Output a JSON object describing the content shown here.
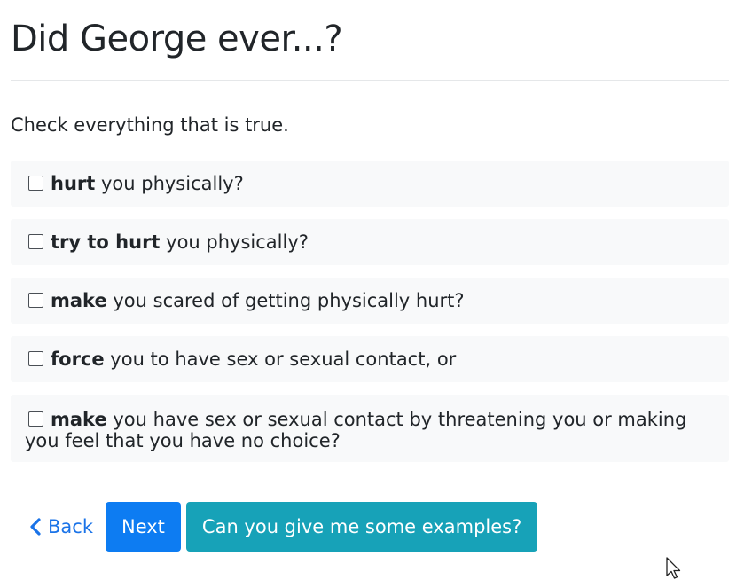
{
  "header": {
    "title": "Did George ever...?"
  },
  "instruction": "Check everything that is true.",
  "options": [
    {
      "bold": "hurt",
      "rest": " you physically?"
    },
    {
      "bold": "try to hurt",
      "rest": " you physically?"
    },
    {
      "bold": "make",
      "rest": " you scared of getting physically hurt?"
    },
    {
      "bold": "force",
      "rest": " you to have sex or sexual contact, or"
    },
    {
      "bold": "make",
      "rest": " you have sex or sexual contact by threatening you or making you feel that you have no choice?"
    }
  ],
  "actions": {
    "back_label": "Back",
    "next_label": "Next",
    "examples_label": "Can you give me some examples?"
  },
  "icons": {
    "back": "chevron-left-icon",
    "checkbox": "checkbox-unchecked-icon",
    "cursor": "mouse-pointer-icon"
  },
  "colors": {
    "primary": "#0d7cf2",
    "info": "#17a2b8",
    "link": "#1a73e8",
    "option_bg": "#f8f9fa"
  }
}
